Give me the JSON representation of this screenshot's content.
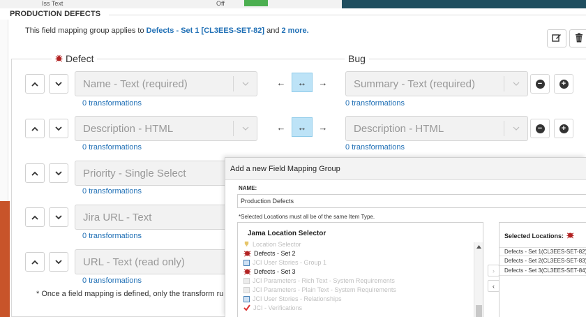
{
  "background": {
    "top_items": [
      "Iss Text",
      "Off",
      "Text"
    ]
  },
  "header": {
    "section_title": "PRODUCTION DEFECTS",
    "applies_prefix": "This field mapping group applies to",
    "applies_link": "Defects - Set 1 [CL3EES-SET-82]",
    "applies_and": "and",
    "applies_more": "2 more."
  },
  "mapping": {
    "left_legend": "Defect",
    "right_legend": "Bug",
    "rows": [
      {
        "left_field": "Name - Text (required)",
        "left_transform": "0 transformations",
        "right_field": "Summary - Text (required)",
        "right_transform": "0 transformations"
      },
      {
        "left_field": "Description - HTML",
        "left_transform": "0 transformations",
        "right_field": "Description - HTML",
        "right_transform": "0 transformations"
      },
      {
        "left_field": "Priority - Single Select",
        "left_transform": "0 transformations"
      },
      {
        "left_field": "Jira URL - Text",
        "left_transform": "0 transformations"
      },
      {
        "left_field": "URL - Text (read only)",
        "left_transform": "0 transformations"
      }
    ],
    "footnote": "* Once a field mapping is defined, only the transform ru"
  },
  "dialog": {
    "title": "Add a new Field Mapping Group",
    "name_label": "NAME:",
    "name_value": "Production Defects",
    "note": "*Selected Locations must all be of the same Item Type.",
    "location_selector_title": "Jama Location Selector",
    "tree": [
      {
        "label": "Location Selector",
        "icon": "trophy-icon",
        "dim": true
      },
      {
        "label": "Defects - Set 2",
        "icon": "bug-icon",
        "dim": false
      },
      {
        "label": "JCI User Stories - Group 1",
        "icon": "story-icon",
        "dim": true
      },
      {
        "label": "Defects - Set 3",
        "icon": "bug-icon",
        "dim": false
      },
      {
        "label": "JCI Parameters - Rich Text - System Requirements",
        "icon": "param-icon",
        "dim": true
      },
      {
        "label": "JCI Parameters - Plain Text - System Requirements",
        "icon": "param-icon",
        "dim": true
      },
      {
        "label": "JCI User Stories - Relationships",
        "icon": "story-icon",
        "dim": true
      },
      {
        "label": "JCI - Verifications",
        "icon": "check-icon",
        "dim": true
      }
    ],
    "selected_title": "Selected Locations:",
    "selected": [
      "Defects - Set 1(CL3EES-SET-82)",
      "Defects - Set 2(CL3EES-SET-83)",
      "Defects - Set 3(CL3EES-SET-84)"
    ]
  }
}
